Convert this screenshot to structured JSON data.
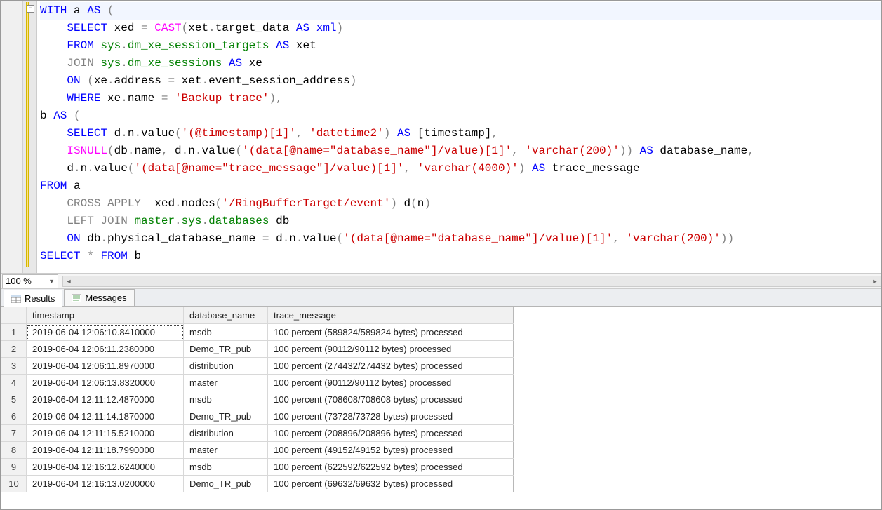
{
  "editor": {
    "zoom_label": "100 %",
    "fold_glyph": "−",
    "code_lines": [
      [
        {
          "c": "kw",
          "t": "WITH"
        },
        {
          "c": "nm",
          "t": " a "
        },
        {
          "c": "kw",
          "t": "AS"
        },
        {
          "c": "op",
          "t": " ("
        }
      ],
      [
        {
          "c": "nm",
          "t": "    "
        },
        {
          "c": "kw",
          "t": "SELECT"
        },
        {
          "c": "nm",
          "t": " xed "
        },
        {
          "c": "op",
          "t": "="
        },
        {
          "c": "nm",
          "t": " "
        },
        {
          "c": "fn",
          "t": "CAST"
        },
        {
          "c": "op",
          "t": "("
        },
        {
          "c": "nm",
          "t": "xet"
        },
        {
          "c": "op",
          "t": "."
        },
        {
          "c": "nm",
          "t": "target_data "
        },
        {
          "c": "kw",
          "t": "AS"
        },
        {
          "c": "nm",
          "t": " "
        },
        {
          "c": "ty",
          "t": "xml"
        },
        {
          "c": "op",
          "t": ")"
        }
      ],
      [
        {
          "c": "nm",
          "t": "    "
        },
        {
          "c": "kw",
          "t": "FROM"
        },
        {
          "c": "nm",
          "t": " "
        },
        {
          "c": "cm",
          "t": "sys"
        },
        {
          "c": "op",
          "t": "."
        },
        {
          "c": "cm",
          "t": "dm_xe_session_targets"
        },
        {
          "c": "nm",
          "t": " "
        },
        {
          "c": "kw",
          "t": "AS"
        },
        {
          "c": "nm",
          "t": " xet"
        }
      ],
      [
        {
          "c": "nm",
          "t": "    "
        },
        {
          "c": "gr",
          "t": "JOIN"
        },
        {
          "c": "nm",
          "t": " "
        },
        {
          "c": "cm",
          "t": "sys"
        },
        {
          "c": "op",
          "t": "."
        },
        {
          "c": "cm",
          "t": "dm_xe_sessions"
        },
        {
          "c": "nm",
          "t": " "
        },
        {
          "c": "kw",
          "t": "AS"
        },
        {
          "c": "nm",
          "t": " xe"
        }
      ],
      [
        {
          "c": "nm",
          "t": "    "
        },
        {
          "c": "kw",
          "t": "ON"
        },
        {
          "c": "nm",
          "t": " "
        },
        {
          "c": "op",
          "t": "("
        },
        {
          "c": "nm",
          "t": "xe"
        },
        {
          "c": "op",
          "t": "."
        },
        {
          "c": "nm",
          "t": "address "
        },
        {
          "c": "op",
          "t": "="
        },
        {
          "c": "nm",
          "t": " xet"
        },
        {
          "c": "op",
          "t": "."
        },
        {
          "c": "nm",
          "t": "event_session_address"
        },
        {
          "c": "op",
          "t": ")"
        }
      ],
      [
        {
          "c": "nm",
          "t": "    "
        },
        {
          "c": "kw",
          "t": "WHERE"
        },
        {
          "c": "nm",
          "t": " xe"
        },
        {
          "c": "op",
          "t": "."
        },
        {
          "c": "nm",
          "t": "name "
        },
        {
          "c": "op",
          "t": "="
        },
        {
          "c": "nm",
          "t": " "
        },
        {
          "c": "st",
          "t": "'Backup trace'"
        },
        {
          "c": "op",
          "t": "),"
        }
      ],
      [
        {
          "c": "nm",
          "t": "b "
        },
        {
          "c": "kw",
          "t": "AS"
        },
        {
          "c": "nm",
          "t": " "
        },
        {
          "c": "op",
          "t": "("
        }
      ],
      [
        {
          "c": "nm",
          "t": "    "
        },
        {
          "c": "kw",
          "t": "SELECT"
        },
        {
          "c": "nm",
          "t": " d"
        },
        {
          "c": "op",
          "t": "."
        },
        {
          "c": "nm",
          "t": "n"
        },
        {
          "c": "op",
          "t": "."
        },
        {
          "c": "nm",
          "t": "value"
        },
        {
          "c": "op",
          "t": "("
        },
        {
          "c": "st",
          "t": "'(@timestamp)[1]'"
        },
        {
          "c": "op",
          "t": ","
        },
        {
          "c": "nm",
          "t": " "
        },
        {
          "c": "st",
          "t": "'datetime2'"
        },
        {
          "c": "op",
          "t": ")"
        },
        {
          "c": "nm",
          "t": " "
        },
        {
          "c": "kw",
          "t": "AS"
        },
        {
          "c": "nm",
          "t": " [timestamp]"
        },
        {
          "c": "op",
          "t": ","
        }
      ],
      [
        {
          "c": "nm",
          "t": "    "
        },
        {
          "c": "fn",
          "t": "ISNULL"
        },
        {
          "c": "op",
          "t": "("
        },
        {
          "c": "nm",
          "t": "db"
        },
        {
          "c": "op",
          "t": "."
        },
        {
          "c": "nm",
          "t": "name"
        },
        {
          "c": "op",
          "t": ","
        },
        {
          "c": "nm",
          "t": " d"
        },
        {
          "c": "op",
          "t": "."
        },
        {
          "c": "nm",
          "t": "n"
        },
        {
          "c": "op",
          "t": "."
        },
        {
          "c": "nm",
          "t": "value"
        },
        {
          "c": "op",
          "t": "("
        },
        {
          "c": "st",
          "t": "'(data[@name=\"database_name\"]/value)[1]'"
        },
        {
          "c": "op",
          "t": ","
        },
        {
          "c": "nm",
          "t": " "
        },
        {
          "c": "st",
          "t": "'varchar(200)'"
        },
        {
          "c": "op",
          "t": "))"
        },
        {
          "c": "nm",
          "t": " "
        },
        {
          "c": "kw",
          "t": "AS"
        },
        {
          "c": "nm",
          "t": " database_name"
        },
        {
          "c": "op",
          "t": ","
        }
      ],
      [
        {
          "c": "nm",
          "t": "    d"
        },
        {
          "c": "op",
          "t": "."
        },
        {
          "c": "nm",
          "t": "n"
        },
        {
          "c": "op",
          "t": "."
        },
        {
          "c": "nm",
          "t": "value"
        },
        {
          "c": "op",
          "t": "("
        },
        {
          "c": "st",
          "t": "'(data[@name=\"trace_message\"]/value)[1]'"
        },
        {
          "c": "op",
          "t": ","
        },
        {
          "c": "nm",
          "t": " "
        },
        {
          "c": "st",
          "t": "'varchar(4000)'"
        },
        {
          "c": "op",
          "t": ")"
        },
        {
          "c": "nm",
          "t": " "
        },
        {
          "c": "kw",
          "t": "AS"
        },
        {
          "c": "nm",
          "t": " trace_message"
        }
      ],
      [
        {
          "c": "kw",
          "t": "FROM"
        },
        {
          "c": "nm",
          "t": " a"
        }
      ],
      [
        {
          "c": "nm",
          "t": "    "
        },
        {
          "c": "gr",
          "t": "CROSS APPLY"
        },
        {
          "c": "nm",
          "t": "  xed"
        },
        {
          "c": "op",
          "t": "."
        },
        {
          "c": "nm",
          "t": "nodes"
        },
        {
          "c": "op",
          "t": "("
        },
        {
          "c": "st",
          "t": "'/RingBufferTarget/event'"
        },
        {
          "c": "op",
          "t": ")"
        },
        {
          "c": "nm",
          "t": " d"
        },
        {
          "c": "op",
          "t": "("
        },
        {
          "c": "nm",
          "t": "n"
        },
        {
          "c": "op",
          "t": ")"
        }
      ],
      [
        {
          "c": "nm",
          "t": "    "
        },
        {
          "c": "gr",
          "t": "LEFT JOIN"
        },
        {
          "c": "nm",
          "t": " "
        },
        {
          "c": "cm",
          "t": "master"
        },
        {
          "c": "op",
          "t": "."
        },
        {
          "c": "cm",
          "t": "sys"
        },
        {
          "c": "op",
          "t": "."
        },
        {
          "c": "cm",
          "t": "databases"
        },
        {
          "c": "nm",
          "t": " db"
        }
      ],
      [
        {
          "c": "nm",
          "t": "    "
        },
        {
          "c": "kw",
          "t": "ON"
        },
        {
          "c": "nm",
          "t": " db"
        },
        {
          "c": "op",
          "t": "."
        },
        {
          "c": "nm",
          "t": "physical_database_name "
        },
        {
          "c": "op",
          "t": "="
        },
        {
          "c": "nm",
          "t": " d"
        },
        {
          "c": "op",
          "t": "."
        },
        {
          "c": "nm",
          "t": "n"
        },
        {
          "c": "op",
          "t": "."
        },
        {
          "c": "nm",
          "t": "value"
        },
        {
          "c": "op",
          "t": "("
        },
        {
          "c": "st",
          "t": "'(data[@name=\"database_name\"]/value)[1]'"
        },
        {
          "c": "op",
          "t": ","
        },
        {
          "c": "nm",
          "t": " "
        },
        {
          "c": "st",
          "t": "'varchar(200)'"
        },
        {
          "c": "op",
          "t": "))"
        }
      ],
      [
        {
          "c": "kw",
          "t": "SELECT"
        },
        {
          "c": "nm",
          "t": " "
        },
        {
          "c": "op",
          "t": "*"
        },
        {
          "c": "nm",
          "t": " "
        },
        {
          "c": "kw",
          "t": "FROM"
        },
        {
          "c": "nm",
          "t": " b"
        }
      ]
    ]
  },
  "tabs": {
    "results_label": "Results",
    "messages_label": "Messages"
  },
  "results": {
    "columns": [
      "timestamp",
      "database_name",
      "trace_message"
    ],
    "rows": [
      [
        "2019-06-04 12:06:10.8410000",
        "msdb",
        "100 percent (589824/589824 bytes) processed"
      ],
      [
        "2019-06-04 12:06:11.2380000",
        "Demo_TR_pub",
        "100 percent (90112/90112 bytes) processed"
      ],
      [
        "2019-06-04 12:06:11.8970000",
        "distribution",
        "100 percent (274432/274432 bytes) processed"
      ],
      [
        "2019-06-04 12:06:13.8320000",
        "master",
        "100 percent (90112/90112 bytes) processed"
      ],
      [
        "2019-06-04 12:11:12.4870000",
        "msdb",
        "100 percent (708608/708608 bytes) processed"
      ],
      [
        "2019-06-04 12:11:14.1870000",
        "Demo_TR_pub",
        "100 percent (73728/73728 bytes) processed"
      ],
      [
        "2019-06-04 12:11:15.5210000",
        "distribution",
        "100 percent (208896/208896 bytes) processed"
      ],
      [
        "2019-06-04 12:11:18.7990000",
        "master",
        "100 percent (49152/49152 bytes) processed"
      ],
      [
        "2019-06-04 12:16:12.6240000",
        "msdb",
        "100 percent (622592/622592 bytes) processed"
      ],
      [
        "2019-06-04 12:16:13.0200000",
        "Demo_TR_pub",
        "100 percent (69632/69632 bytes) processed"
      ]
    ]
  }
}
